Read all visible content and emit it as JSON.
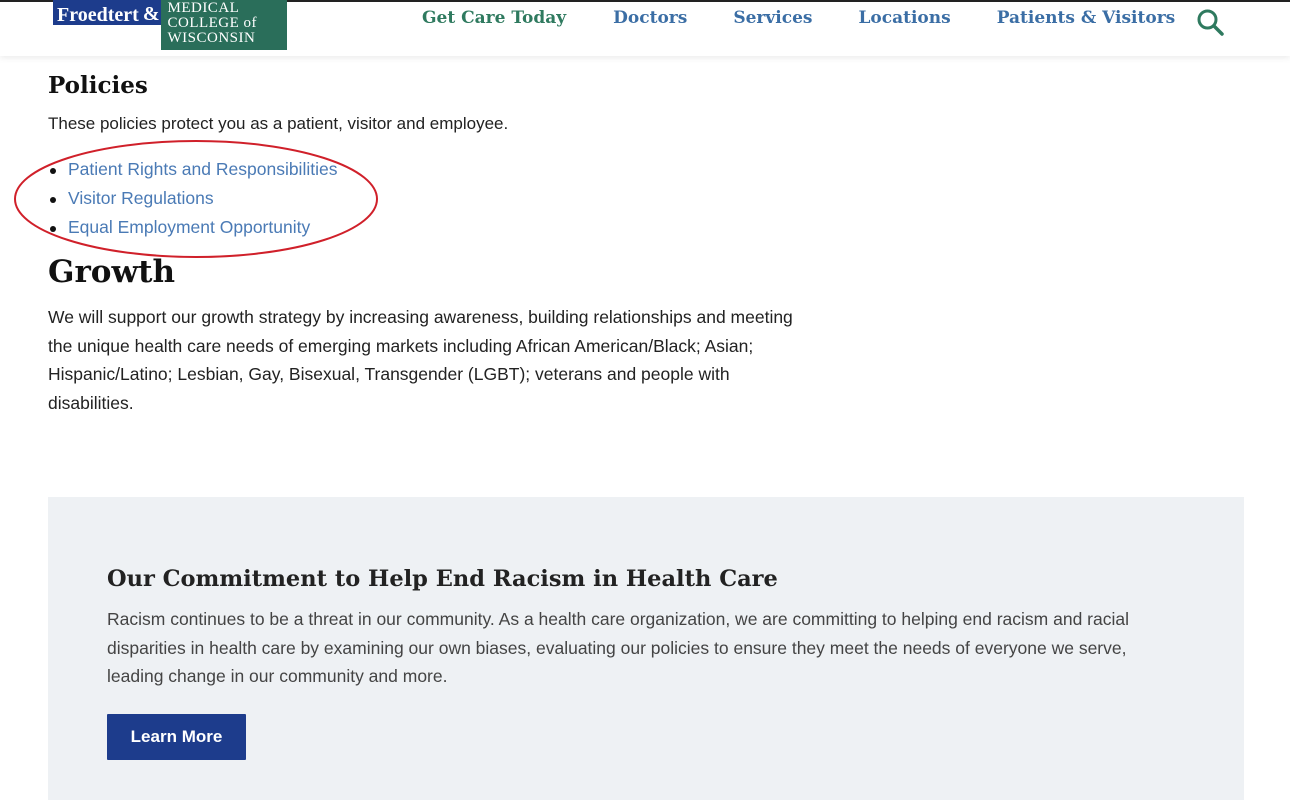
{
  "header": {
    "logo": {
      "froedtert": "Froedtert",
      "amp": "&",
      "mcw_line1": "MEDICAL",
      "mcw_line2": "COLLEGE of",
      "mcw_line3": "WISCONSIN"
    },
    "nav": [
      {
        "label": "Get Care Today"
      },
      {
        "label": "Doctors"
      },
      {
        "label": "Services"
      },
      {
        "label": "Locations"
      },
      {
        "label": "Patients & Visitors"
      }
    ],
    "search_icon": "search-icon"
  },
  "policies": {
    "heading": "Policies",
    "intro": "These policies protect you as a patient, visitor and employee.",
    "links": [
      {
        "label": "Patient Rights and Responsibilities"
      },
      {
        "label": "Visitor Regulations"
      },
      {
        "label": "Equal Employment Opportunity"
      }
    ]
  },
  "growth": {
    "heading": "Growth",
    "text": "We will support our growth strategy by increasing awareness, building relationships and meeting the unique health care needs of emerging markets including African American/Black; Asian; Hispanic/Latino; Lesbian, Gay, Bisexual, Transgender (LGBT); veterans and people with disabilities."
  },
  "commitment": {
    "heading": "Our Commitment to Help End Racism in Health Care",
    "text": "Racism continues to be a threat in our community. As a health care organization, we are committing to helping end racism and racial disparities in health care by examining our own biases, evaluating our policies to ensure they meet the needs of everyone we serve, leading change in our community and more.",
    "button_label": "Learn More"
  },
  "colors": {
    "nav_green": "#2f7a5f",
    "nav_blue": "#3b6ea5",
    "link_blue": "#4a7ab5",
    "brand_navy": "#1d3c8c",
    "brand_green": "#2a6e5a",
    "panel_bg": "#eef1f4",
    "annotation_red": "#d0202a"
  }
}
